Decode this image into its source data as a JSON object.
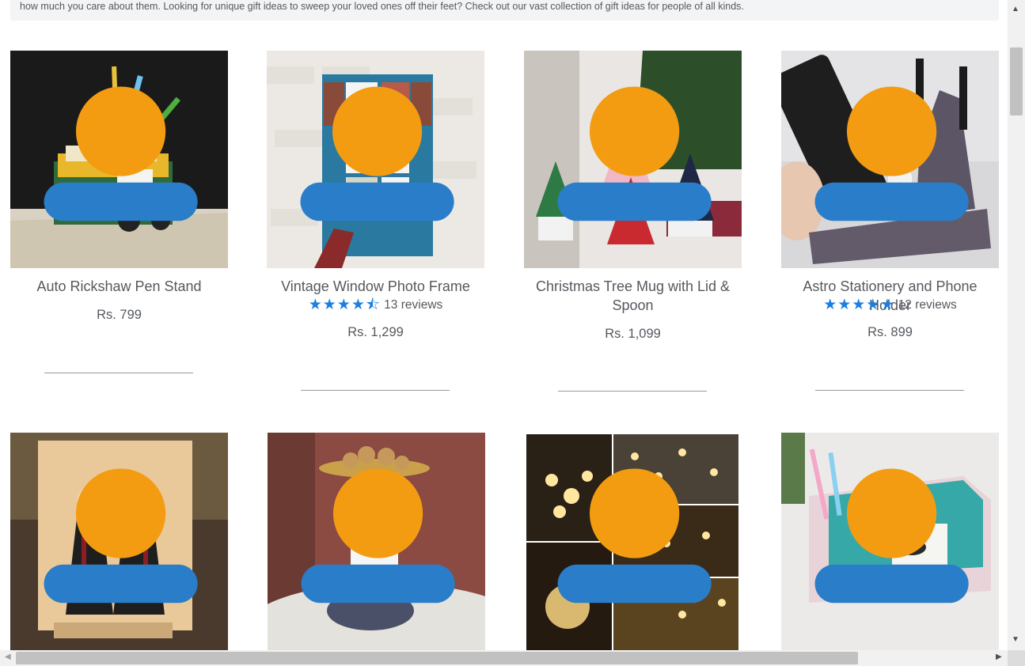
{
  "intro": {
    "text": "how much you care about them. Looking for unique gift ideas to sweep your loved ones off their feet? Check out our vast collection of gift ideas for people of all kinds."
  },
  "products": [
    {
      "title": "Auto Rickshaw Pen Stand",
      "price": "Rs. 799"
    },
    {
      "title": "Vintage Window Photo Frame",
      "stars": "★★★★⯪",
      "rating": 4.5,
      "reviews": "13 reviews",
      "price": "Rs. 1,299"
    },
    {
      "title_line1": "Christmas Tree Mug with Lid &",
      "title_line2": "Spoon",
      "price": "Rs. 1,099"
    },
    {
      "title": "Astro Stationery and Phone Holder",
      "stars": "★★★★★",
      "rating": 5,
      "reviews": "12 reviews",
      "price": "Rs. 899"
    }
  ],
  "second_row_images": [
    "couple-caricature-frame",
    "astronaut-tray",
    "fairy-bulb-lights",
    "desk-organizer"
  ],
  "colors": {
    "text": "#55595e",
    "star": "#1a7fe0",
    "intro_bg": "#f3f4f5"
  },
  "icons": {
    "scroll_up": "▲",
    "scroll_down": "▼",
    "scroll_left": "◀",
    "scroll_right": "▶"
  }
}
